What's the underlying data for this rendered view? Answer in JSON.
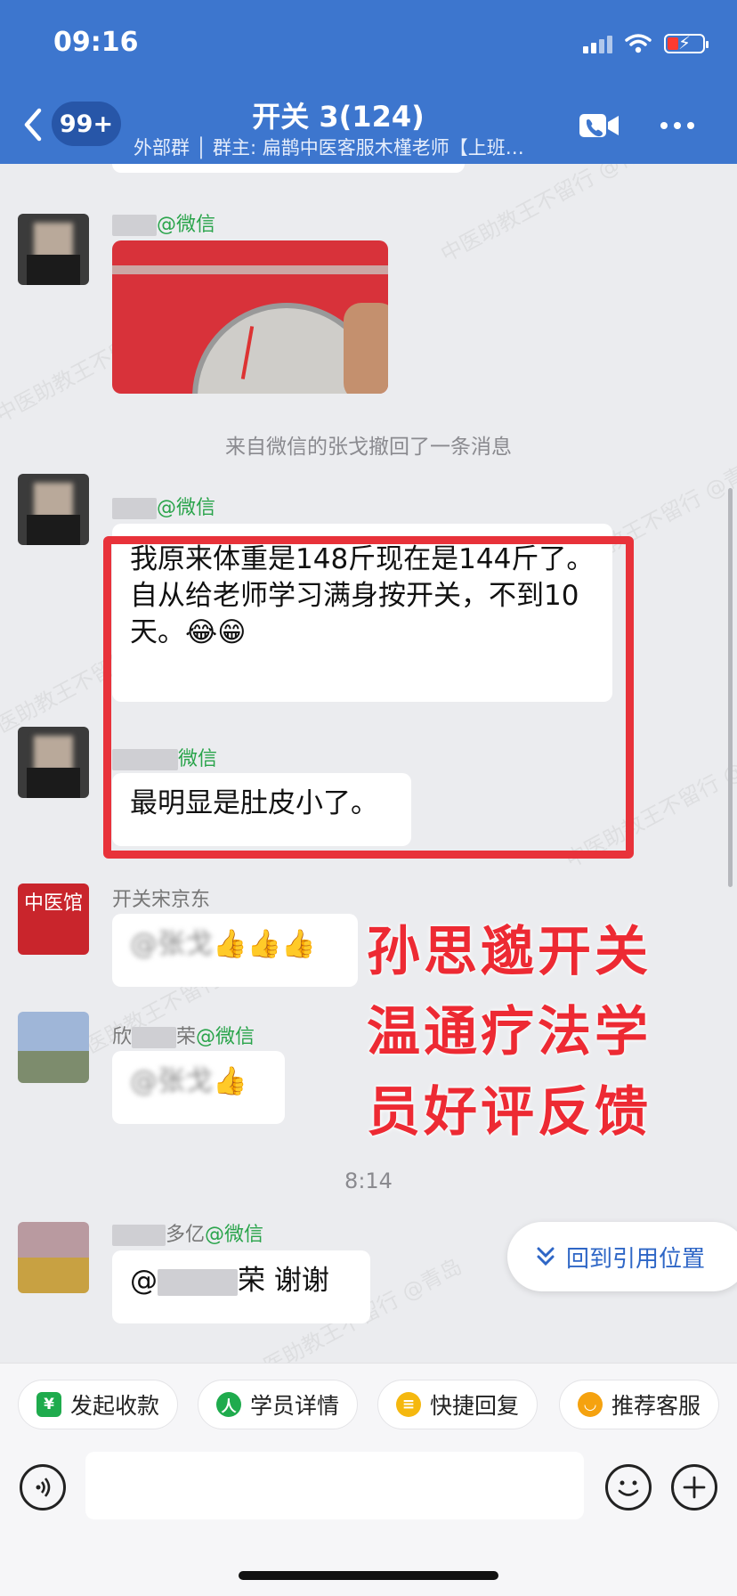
{
  "status": {
    "time": "09:16"
  },
  "header": {
    "back_badge": "99+",
    "title": "开关 3(124)",
    "subtitle": "外部群 │ 群主: 扁鹊中医客服木槿老师【上班…"
  },
  "messages": [
    {
      "sender_suffix": "@微信",
      "type": "image"
    },
    {
      "type": "system",
      "text": "来自微信的张戈撤回了一条消息"
    },
    {
      "sender_suffix": "@微信",
      "text": "我原来体重是148斤现在是144斤了。\n自从给老师学习满身按开关，不到10天。😂😁"
    },
    {
      "sender_suffix": "微信",
      "text": "最明显是肚皮小了。"
    },
    {
      "sender": "开关宋京东",
      "text_prefix": "@张戈",
      "emoji": "👍👍👍"
    },
    {
      "sender_part1": "欣",
      "sender_part2": "荣",
      "sender_suffix": "@微信",
      "text_prefix": "@张戈",
      "emoji": "👍"
    },
    {
      "type": "time",
      "text": "8:14"
    },
    {
      "sender_part": "多亿",
      "sender_suffix": "@微信",
      "text_prefix": "@",
      "text_suffix": "荣 谢谢"
    }
  ],
  "avatar_text": "中医馆",
  "overlay": {
    "line1": "孙思邈开关",
    "line2": "温通疗法学",
    "line3": "员好评反馈"
  },
  "watermark": "中医助教王不留行 @青岛",
  "return_button": "回到引用位置",
  "quick_actions": [
    {
      "label": "发起收款",
      "icon": "¥",
      "color": "#1fab4d"
    },
    {
      "label": "学员详情",
      "icon": "人",
      "color": "#1fab4d"
    },
    {
      "label": "快捷回复",
      "icon": "≡",
      "color": "#f5b80f"
    },
    {
      "label": "推荐客服",
      "icon": "◡",
      "color": "#f5a20f"
    }
  ],
  "input": {
    "placeholder": ""
  }
}
